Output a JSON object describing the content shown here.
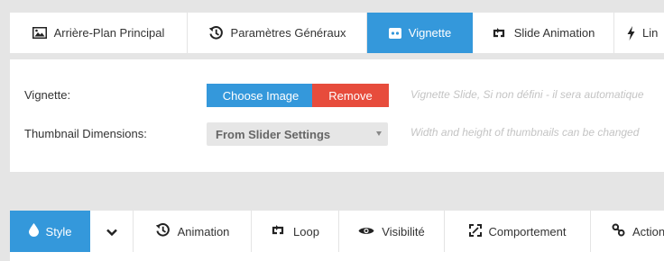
{
  "top_tabs": [
    {
      "label": "Arrière-Plan Principal",
      "icon": "image-icon",
      "active": false
    },
    {
      "label": "Paramètres Généraux",
      "icon": "history-icon",
      "active": false
    },
    {
      "label": "Vignette",
      "icon": "thumbnail-icon",
      "active": true
    },
    {
      "label": "Slide Animation",
      "icon": "loop-icon",
      "active": false
    },
    {
      "label": "Lin",
      "icon": "bolt-icon",
      "active": false
    }
  ],
  "settings": {
    "thumbnail_label": "Vignette:",
    "choose_image": "Choose Image",
    "remove": "Remove",
    "thumbnail_hint": "Vignette Slide, Si non défini - il sera automatique",
    "dimensions_label": "Thumbnail Dimensions:",
    "dimensions_value": "From Slider Settings",
    "dimensions_hint": "Width and height of thumbnails can be changed"
  },
  "bottom_tabs": [
    {
      "label": "Style",
      "icon": "drop-icon",
      "active": true
    },
    {
      "label": "",
      "icon": "chevron-down-icon",
      "active": false
    },
    {
      "label": "Animation",
      "icon": "history-icon",
      "active": false
    },
    {
      "label": "Loop",
      "icon": "loop-icon",
      "active": false
    },
    {
      "label": "Visibilité",
      "icon": "eye-icon",
      "active": false
    },
    {
      "label": "Comportement",
      "icon": "expand-icon",
      "active": false
    },
    {
      "label": "Action",
      "icon": "link-icon",
      "active": false
    }
  ],
  "colors": {
    "accent": "#3498db",
    "danger": "#e74c3c",
    "background": "#e5e5e5"
  }
}
